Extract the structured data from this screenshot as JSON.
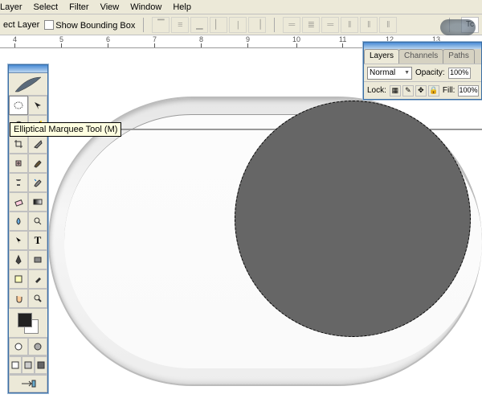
{
  "menu": {
    "items": [
      "Layer",
      "Select",
      "Filter",
      "View",
      "Window",
      "Help"
    ]
  },
  "options": {
    "layer_label": "ect Layer",
    "bounding_label": "Show Bounding Box",
    "tc_label": "Tc"
  },
  "ruler": {
    "labels": [
      "4",
      "5",
      "6",
      "7",
      "8",
      "9",
      "10",
      "11",
      "12",
      "13"
    ]
  },
  "tooltip": "Elliptical Marquee Tool (M)",
  "tools": {
    "feather": "feather-icon",
    "grid": [
      "marquee-icon",
      "move-icon",
      "lasso-icon",
      "wand-icon",
      "crop-icon",
      "slice-icon",
      "healing-icon",
      "brush-icon",
      "stamp-icon",
      "history-brush-icon",
      "eraser-icon",
      "gradient-icon",
      "blur-icon",
      "dodge-icon",
      "path-select-icon",
      "type-icon",
      "pen-icon",
      "shape-icon",
      "notes-icon",
      "eyedropper-icon",
      "hand-icon",
      "zoom-icon"
    ],
    "row_mode": [
      "standard-mode-icon",
      "quickmask-mode-icon"
    ],
    "row_screen": [
      "screen-std-icon",
      "screen-full-menu-icon",
      "screen-full-icon"
    ],
    "row_jump": [
      "jump-to-icon",
      "spacer"
    ]
  },
  "layers": {
    "tabs": [
      "Layers",
      "Channels",
      "Paths"
    ],
    "blend": "Normal",
    "opacity_label": "Opacity:",
    "opacity_value": "100%",
    "lock_label": "Lock:",
    "fill_label": "Fill:",
    "fill_value": "100%"
  }
}
